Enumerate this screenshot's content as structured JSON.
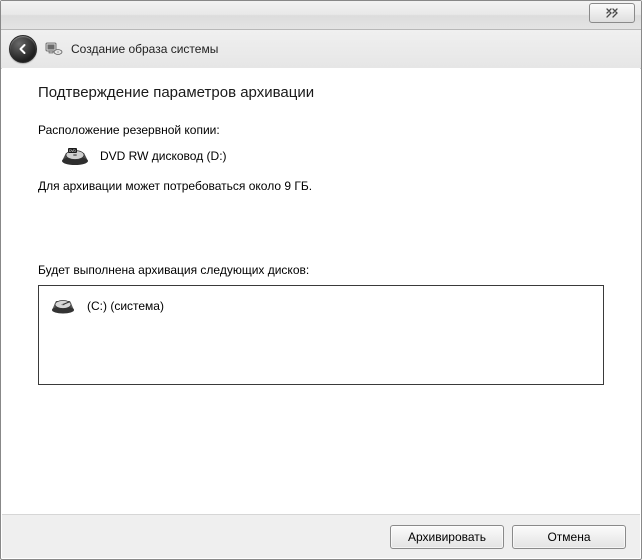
{
  "header": {
    "title": "Создание образа системы"
  },
  "content": {
    "heading": "Подтверждение параметров архивации",
    "backup_location_label": "Расположение резервной копии:",
    "destination": "DVD RW дисковод (D:)",
    "size_note": "Для архивации может потребоваться около 9 ГБ.",
    "disks_label": "Будет выполнена архивация следующих дисков:",
    "disks": [
      {
        "label": "(C:) (система)"
      }
    ]
  },
  "footer": {
    "archive_label": "Архивировать",
    "cancel_label": "Отмена"
  }
}
